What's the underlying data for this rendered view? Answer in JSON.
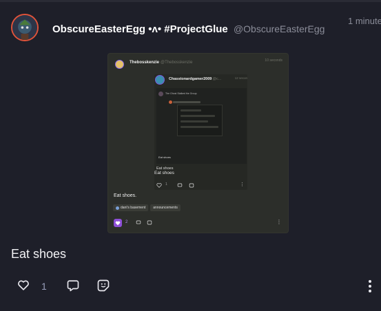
{
  "post": {
    "display_name": "ObscureEasterEgg •ʌ• #ProjectGlue",
    "handle": "@ObscureEasterEgg",
    "timestamp": "1 minute",
    "text": "Eat shoes",
    "like_count": "1"
  },
  "embed_level1": {
    "display_name": "Thebosskenzie",
    "handle": "@Thebosskenzie",
    "timestamp": "10 seconds",
    "text": "Eat shoes.",
    "tags": [
      "dani's basement",
      "announcements"
    ],
    "like_count": "2"
  },
  "embed_level2": {
    "display_name": "Chasstonardgamer2009",
    "handle": "@c...",
    "timestamp": "12 secon",
    "text": "Eat shoes",
    "like_count": "1"
  },
  "embed_level3": {
    "title": "The Ghost Stalked the Group",
    "text": "Eat shoes"
  },
  "colors": {
    "background": "#1e1f29",
    "avatar_ring": "#e0533a",
    "accent_purple": "#8e4fd8",
    "muted": "#8b8d99"
  },
  "icons": [
    "heart-icon",
    "comment-icon",
    "sticker-icon",
    "more-vertical-icon"
  ]
}
